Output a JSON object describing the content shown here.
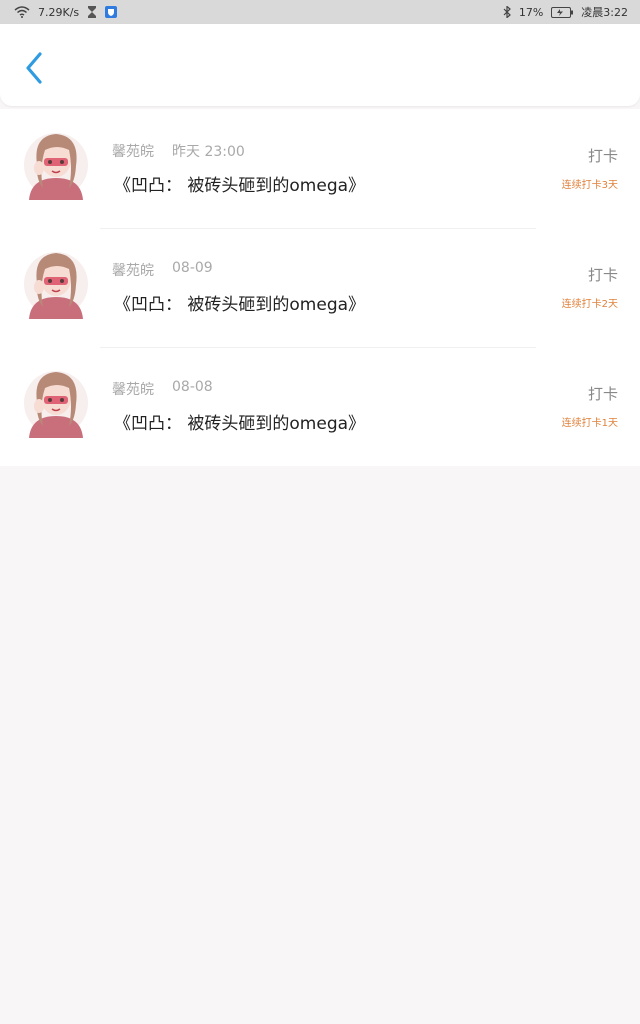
{
  "status_bar": {
    "speed": "7.29K/s",
    "battery": "17%",
    "time": "凌晨3:22"
  },
  "header": {
    "back_icon": "chevron-left-icon",
    "accent_color": "#2f9be0"
  },
  "checkins": [
    {
      "user": "馨苑皖",
      "time": "昨天 23:00",
      "text": "《凹凸： 被砖头砸到的omega》",
      "action": "打卡",
      "streak": "连续打卡3天"
    },
    {
      "user": "馨苑皖",
      "time": "08-09",
      "text": "《凹凸： 被砖头砸到的omega》",
      "action": "打卡",
      "streak": "连续打卡2天"
    },
    {
      "user": "馨苑皖",
      "time": "08-08",
      "text": "《凹凸： 被砖头砸到的omega》",
      "action": "打卡",
      "streak": "连续打卡1天"
    }
  ]
}
